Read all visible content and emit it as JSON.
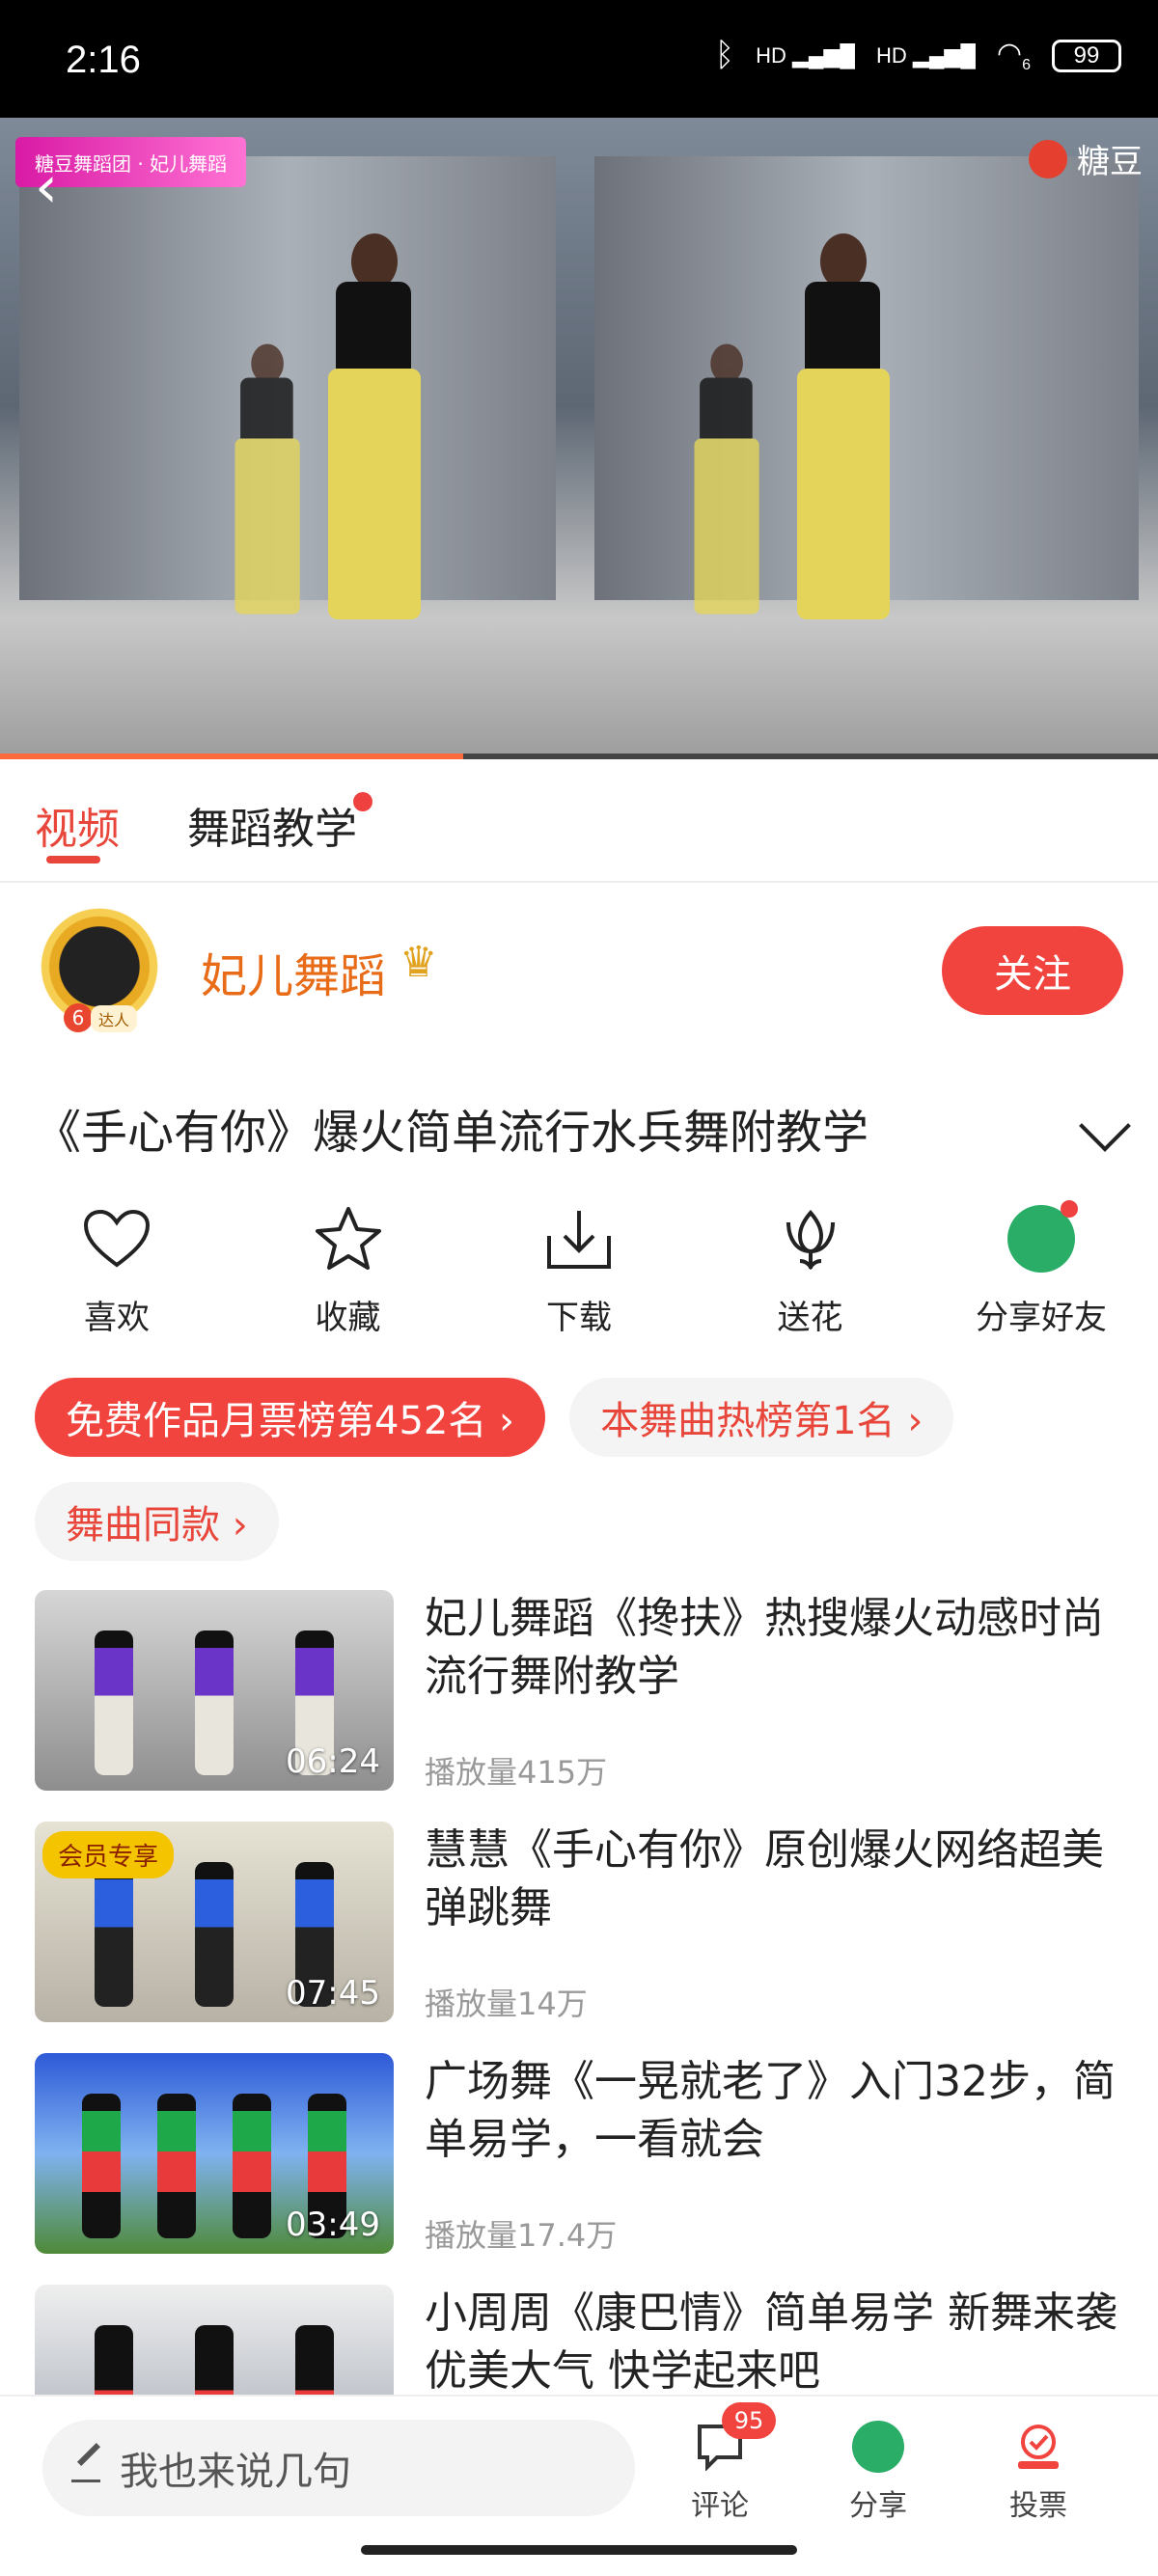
{
  "status_bar": {
    "time": "2:16",
    "battery": "99",
    "network_label": "HD",
    "wifi_sub": "6"
  },
  "video": {
    "brand_badge": "糖豆舞蹈团 · 妃儿舞蹈",
    "watermark": "糖豆",
    "progress_fraction": 0.4
  },
  "tabs": {
    "video": "视频",
    "teaching": "舞蹈教学"
  },
  "author": {
    "name": "妃儿舞蹈",
    "level": "6",
    "tag": "达人",
    "follow_label": "关注"
  },
  "title": "《手心有你》爆火简单流行水兵舞附教学",
  "actions": [
    {
      "label": "喜欢",
      "icon": "heart-icon"
    },
    {
      "label": "收藏",
      "icon": "star-icon"
    },
    {
      "label": "下载",
      "icon": "download-icon"
    },
    {
      "label": "送花",
      "icon": "flower-icon"
    },
    {
      "label": "分享好友",
      "icon": "wechat-icon"
    }
  ],
  "chips": [
    {
      "label": "免费作品月票榜第452名 ›"
    },
    {
      "label": "本舞曲热榜第1名 ›"
    },
    {
      "label": "舞曲同款 ›"
    }
  ],
  "list": [
    {
      "title": "妃儿舞蹈《搀扶》热搜爆火动感时尚流行舞附教学",
      "views": "播放量415万",
      "duration": "06:24"
    },
    {
      "title": "慧慧《手心有你》原创爆火网络超美弹跳舞",
      "views": "播放量14万",
      "duration": "07:45",
      "badge": "会员专享"
    },
    {
      "title": "广场舞《一晃就老了》入门32步，简单易学，一看就会",
      "views": "播放量17.4万",
      "duration": "03:49"
    },
    {
      "title": "小周周《康巴情》简单易学 新舞来袭 优美大气 快学起来吧",
      "views": "",
      "duration": ""
    }
  ],
  "bottom_bar": {
    "comment_placeholder": "我也来说几句",
    "comment_label": "评论",
    "comment_count": "95",
    "share_label": "分享",
    "vote_label": "投票"
  },
  "colors": {
    "accent": "#f2443f",
    "author_name": "#e86b18",
    "wechat": "#2aae67"
  }
}
